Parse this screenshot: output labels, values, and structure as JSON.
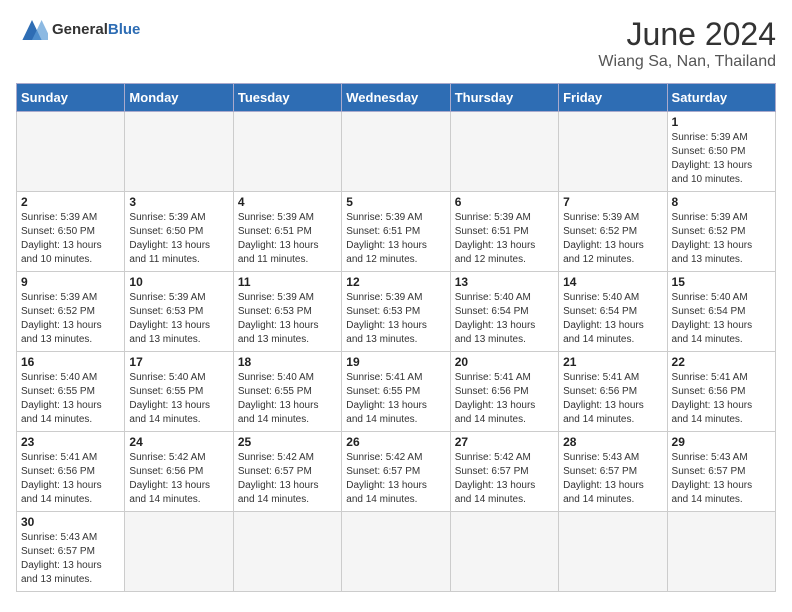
{
  "header": {
    "logo_general": "General",
    "logo_blue": "Blue",
    "title": "June 2024",
    "subtitle": "Wiang Sa, Nan, Thailand"
  },
  "days_of_week": [
    "Sunday",
    "Monday",
    "Tuesday",
    "Wednesday",
    "Thursday",
    "Friday",
    "Saturday"
  ],
  "weeks": [
    [
      {
        "day": "",
        "info": "",
        "empty": true
      },
      {
        "day": "",
        "info": "",
        "empty": true
      },
      {
        "day": "",
        "info": "",
        "empty": true
      },
      {
        "day": "",
        "info": "",
        "empty": true
      },
      {
        "day": "",
        "info": "",
        "empty": true
      },
      {
        "day": "",
        "info": "",
        "empty": true
      },
      {
        "day": "1",
        "info": "Sunrise: 5:39 AM\nSunset: 6:50 PM\nDaylight: 13 hours\nand 10 minutes."
      }
    ],
    [
      {
        "day": "2",
        "info": "Sunrise: 5:39 AM\nSunset: 6:50 PM\nDaylight: 13 hours\nand 10 minutes."
      },
      {
        "day": "3",
        "info": "Sunrise: 5:39 AM\nSunset: 6:50 PM\nDaylight: 13 hours\nand 11 minutes."
      },
      {
        "day": "4",
        "info": "Sunrise: 5:39 AM\nSunset: 6:51 PM\nDaylight: 13 hours\nand 11 minutes."
      },
      {
        "day": "5",
        "info": "Sunrise: 5:39 AM\nSunset: 6:51 PM\nDaylight: 13 hours\nand 12 minutes."
      },
      {
        "day": "6",
        "info": "Sunrise: 5:39 AM\nSunset: 6:51 PM\nDaylight: 13 hours\nand 12 minutes."
      },
      {
        "day": "7",
        "info": "Sunrise: 5:39 AM\nSunset: 6:52 PM\nDaylight: 13 hours\nand 12 minutes."
      },
      {
        "day": "8",
        "info": "Sunrise: 5:39 AM\nSunset: 6:52 PM\nDaylight: 13 hours\nand 13 minutes."
      }
    ],
    [
      {
        "day": "9",
        "info": "Sunrise: 5:39 AM\nSunset: 6:52 PM\nDaylight: 13 hours\nand 13 minutes."
      },
      {
        "day": "10",
        "info": "Sunrise: 5:39 AM\nSunset: 6:53 PM\nDaylight: 13 hours\nand 13 minutes."
      },
      {
        "day": "11",
        "info": "Sunrise: 5:39 AM\nSunset: 6:53 PM\nDaylight: 13 hours\nand 13 minutes."
      },
      {
        "day": "12",
        "info": "Sunrise: 5:39 AM\nSunset: 6:53 PM\nDaylight: 13 hours\nand 13 minutes."
      },
      {
        "day": "13",
        "info": "Sunrise: 5:40 AM\nSunset: 6:54 PM\nDaylight: 13 hours\nand 13 minutes."
      },
      {
        "day": "14",
        "info": "Sunrise: 5:40 AM\nSunset: 6:54 PM\nDaylight: 13 hours\nand 14 minutes."
      },
      {
        "day": "15",
        "info": "Sunrise: 5:40 AM\nSunset: 6:54 PM\nDaylight: 13 hours\nand 14 minutes."
      }
    ],
    [
      {
        "day": "16",
        "info": "Sunrise: 5:40 AM\nSunset: 6:55 PM\nDaylight: 13 hours\nand 14 minutes."
      },
      {
        "day": "17",
        "info": "Sunrise: 5:40 AM\nSunset: 6:55 PM\nDaylight: 13 hours\nand 14 minutes."
      },
      {
        "day": "18",
        "info": "Sunrise: 5:40 AM\nSunset: 6:55 PM\nDaylight: 13 hours\nand 14 minutes."
      },
      {
        "day": "19",
        "info": "Sunrise: 5:41 AM\nSunset: 6:55 PM\nDaylight: 13 hours\nand 14 minutes."
      },
      {
        "day": "20",
        "info": "Sunrise: 5:41 AM\nSunset: 6:56 PM\nDaylight: 13 hours\nand 14 minutes."
      },
      {
        "day": "21",
        "info": "Sunrise: 5:41 AM\nSunset: 6:56 PM\nDaylight: 13 hours\nand 14 minutes."
      },
      {
        "day": "22",
        "info": "Sunrise: 5:41 AM\nSunset: 6:56 PM\nDaylight: 13 hours\nand 14 minutes."
      }
    ],
    [
      {
        "day": "23",
        "info": "Sunrise: 5:41 AM\nSunset: 6:56 PM\nDaylight: 13 hours\nand 14 minutes."
      },
      {
        "day": "24",
        "info": "Sunrise: 5:42 AM\nSunset: 6:56 PM\nDaylight: 13 hours\nand 14 minutes."
      },
      {
        "day": "25",
        "info": "Sunrise: 5:42 AM\nSunset: 6:57 PM\nDaylight: 13 hours\nand 14 minutes."
      },
      {
        "day": "26",
        "info": "Sunrise: 5:42 AM\nSunset: 6:57 PM\nDaylight: 13 hours\nand 14 minutes."
      },
      {
        "day": "27",
        "info": "Sunrise: 5:42 AM\nSunset: 6:57 PM\nDaylight: 13 hours\nand 14 minutes."
      },
      {
        "day": "28",
        "info": "Sunrise: 5:43 AM\nSunset: 6:57 PM\nDaylight: 13 hours\nand 14 minutes."
      },
      {
        "day": "29",
        "info": "Sunrise: 5:43 AM\nSunset: 6:57 PM\nDaylight: 13 hours\nand 14 minutes."
      }
    ],
    [
      {
        "day": "30",
        "info": "Sunrise: 5:43 AM\nSunset: 6:57 PM\nDaylight: 13 hours\nand 13 minutes."
      },
      {
        "day": "",
        "info": "",
        "empty": true
      },
      {
        "day": "",
        "info": "",
        "empty": true
      },
      {
        "day": "",
        "info": "",
        "empty": true
      },
      {
        "day": "",
        "info": "",
        "empty": true
      },
      {
        "day": "",
        "info": "",
        "empty": true
      },
      {
        "day": "",
        "info": "",
        "empty": true
      }
    ]
  ]
}
